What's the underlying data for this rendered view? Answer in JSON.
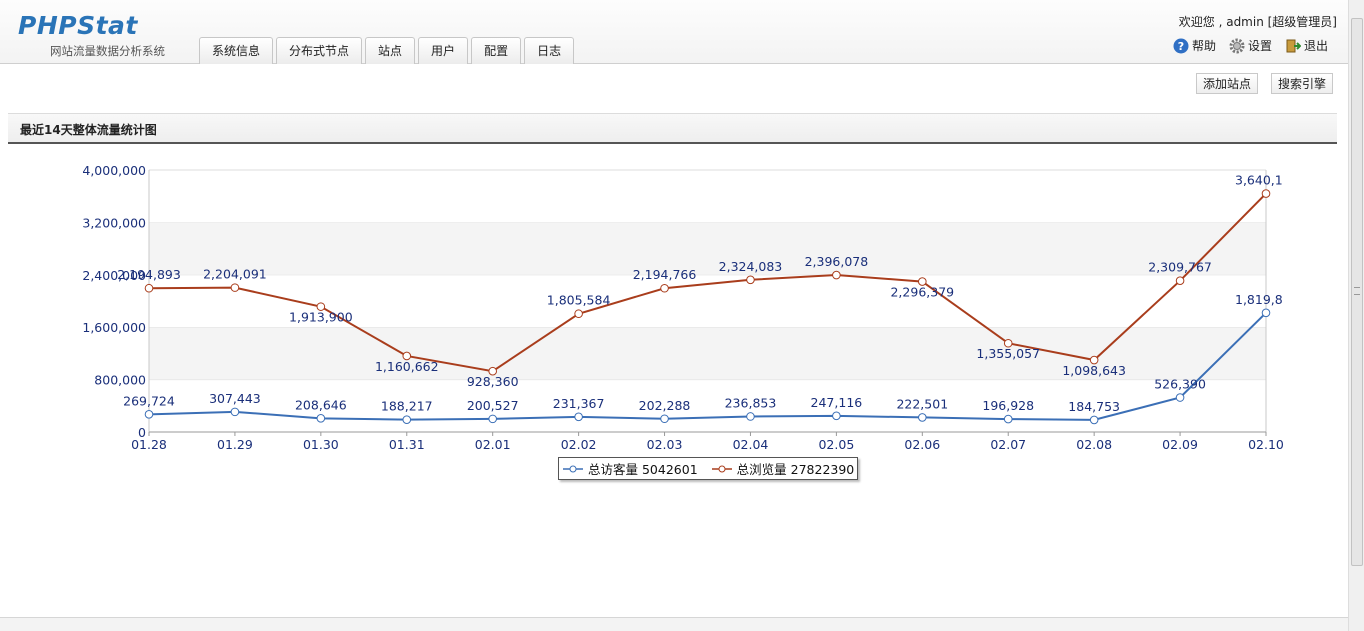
{
  "header": {
    "logo_main": "PHPStat",
    "logo_sub": "网站流量数据分析系统",
    "welcome": "欢迎您 , admin [超级管理员]",
    "tabs": [
      "系统信息",
      "分布式节点",
      "站点",
      "用户",
      "配置",
      "日志"
    ],
    "links": {
      "help": "帮助",
      "settings": "设置",
      "logout": "退出"
    }
  },
  "actions": {
    "add_site": "添加站点",
    "search_engine": "搜索引擎"
  },
  "panel": {
    "title": "最近14天整体流量统计图"
  },
  "colors": {
    "visits": "#3b6fb6",
    "pageviews": "#a93d1c"
  },
  "chart_data": {
    "type": "line",
    "categories": [
      "01.28",
      "01.29",
      "01.30",
      "01.31",
      "02.01",
      "02.02",
      "02.03",
      "02.04",
      "02.05",
      "02.06",
      "02.07",
      "02.08",
      "02.09",
      "02.10"
    ],
    "ylim": [
      0,
      4000000
    ],
    "yticks": [
      "0",
      "800,000",
      "1,600,000",
      "2,400,000",
      "3,200,000",
      "4,000,000"
    ],
    "grid": true,
    "legend_position": "bottom",
    "series": [
      {
        "name": "总访客量 5042601",
        "values": [
          269724,
          307443,
          208646,
          188217,
          200527,
          231367,
          202288,
          236853,
          247116,
          222501,
          196928,
          184753,
          526390,
          1819800
        ],
        "labels": [
          "269,724",
          "307,443",
          "208,646",
          "188,217",
          "200,527",
          "231,367",
          "202,288",
          "236,853",
          "247,116",
          "222,501",
          "196,928",
          "184,753",
          "526,390",
          "1,819,8"
        ]
      },
      {
        "name": "总浏览量 27822390",
        "values": [
          2194893,
          2204091,
          1913900,
          1160662,
          928360,
          1805584,
          2194766,
          2324083,
          2396078,
          2296379,
          1355057,
          1098643,
          2309767,
          3640100
        ],
        "labels": [
          "2,194,893",
          "2,204,091",
          "1,913,900",
          "1,160,662",
          "928,360",
          "1,805,584",
          "2,194,766",
          "2,324,083",
          "2,396,078",
          "2,296,379",
          "1,355,057",
          "1,098,643",
          "2,309,767",
          "3,640,1"
        ]
      }
    ]
  }
}
